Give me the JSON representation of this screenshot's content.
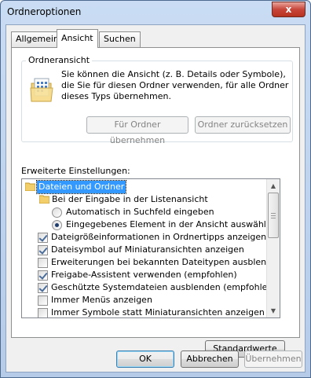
{
  "window": {
    "title": "Ordneroptionen",
    "close_glyph": "x"
  },
  "tabs": [
    {
      "label": "Allgemein",
      "active": false
    },
    {
      "label": "Ansicht",
      "active": true
    },
    {
      "label": "Suchen",
      "active": false
    }
  ],
  "folder_view": {
    "group_label": "Ordneransicht",
    "description": "Sie können die Ansicht (z. B. Details oder Symbole), die Sie für diesen Ordner verwenden, für alle Ordner dieses Typs übernehmen.",
    "apply_button": "Für Ordner übernehmen",
    "reset_button": "Ordner zurücksetzen"
  },
  "advanced": {
    "label": "Erweiterte Einstellungen:",
    "items": [
      {
        "type": "folder",
        "level": 0,
        "text": "Dateien und Ordner",
        "selected": true
      },
      {
        "type": "folder",
        "level": 1,
        "text": "Bei der Eingabe in der Listenansicht"
      },
      {
        "type": "radio",
        "level": 2,
        "text": "Automatisch in Suchfeld eingeben",
        "checked": false
      },
      {
        "type": "radio",
        "level": 2,
        "text": "Eingegebenes Element in der Ansicht auswählen",
        "checked": true
      },
      {
        "type": "checkbox",
        "level": 1,
        "text": "Dateigrößeinformationen in Ordnertipps anzeigen",
        "checked": true
      },
      {
        "type": "checkbox",
        "level": 1,
        "text": "Dateisymbol auf Miniaturansichten anzeigen",
        "checked": true
      },
      {
        "type": "checkbox",
        "level": 1,
        "text": "Erweiterungen bei bekannten Dateitypen ausblenden",
        "checked": false
      },
      {
        "type": "checkbox",
        "level": 1,
        "text": "Freigabe-Assistent verwenden (empfohlen)",
        "checked": true
      },
      {
        "type": "checkbox",
        "level": 1,
        "text": "Geschützte Systemdateien ausblenden (empfohlen)",
        "checked": true
      },
      {
        "type": "checkbox",
        "level": 1,
        "text": "Immer Menüs anzeigen",
        "checked": false
      },
      {
        "type": "checkbox",
        "level": 1,
        "text": "Immer Symbole statt Miniaturansichten anzeigen",
        "checked": false
      }
    ]
  },
  "buttons": {
    "defaults": "Standardwerte",
    "ok": "OK",
    "cancel": "Abbrechen",
    "apply": "Übernehmen"
  },
  "colors": {
    "selection": "#3399ff",
    "titlebar": "#c9dcf3"
  }
}
